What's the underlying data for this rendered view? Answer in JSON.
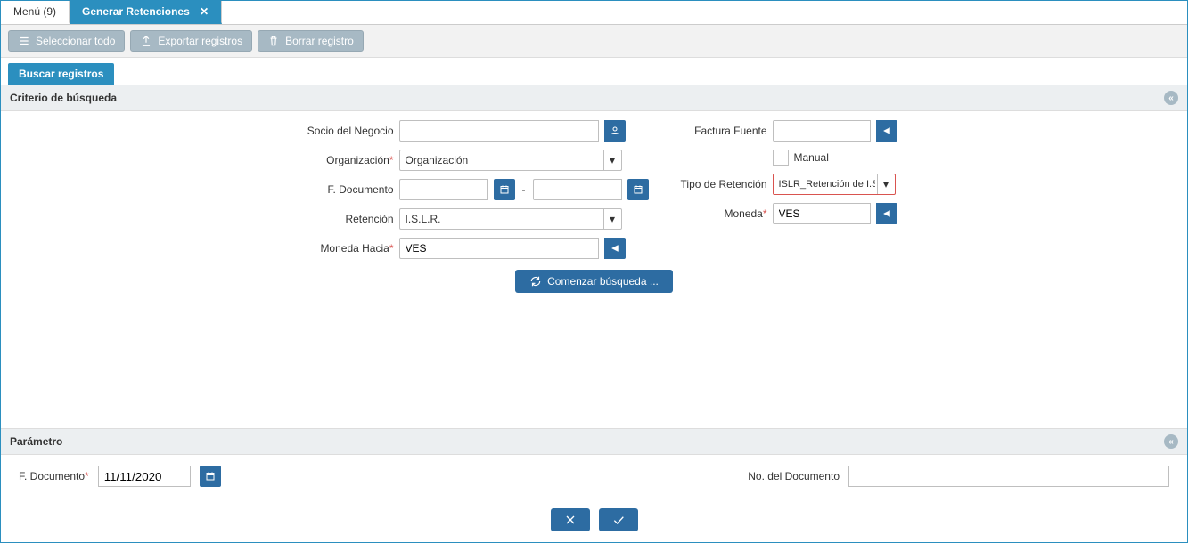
{
  "tabs": {
    "menu": "Menú (9)",
    "active_tab": "Generar Retenciones"
  },
  "toolbar": {
    "select_all": "Seleccionar todo",
    "export": "Exportar registros",
    "delete": "Borrar registro"
  },
  "subtab": {
    "search_records": "Buscar registros"
  },
  "sections": {
    "search_criteria": "Criterio de búsqueda",
    "parameter": "Parámetro"
  },
  "labels": {
    "business_partner": "Socio del Negocio",
    "organization": "Organización",
    "doc_date": "F. Documento",
    "retention": "Retención",
    "currency_to": "Moneda Hacia",
    "invoice_source": "Factura Fuente",
    "manual": "Manual",
    "retention_type": "Tipo de Retención",
    "currency": "Moneda",
    "doc_number": "No. del Documento"
  },
  "values": {
    "organization": "Organización",
    "retention": "I.S.L.R.",
    "currency_to": "VES",
    "retention_type": "ISLR_Retención de I.S.L.",
    "currency": "VES",
    "param_doc_date": "11/11/2020"
  },
  "buttons": {
    "begin_search": "Comenzar búsqueda ..."
  }
}
